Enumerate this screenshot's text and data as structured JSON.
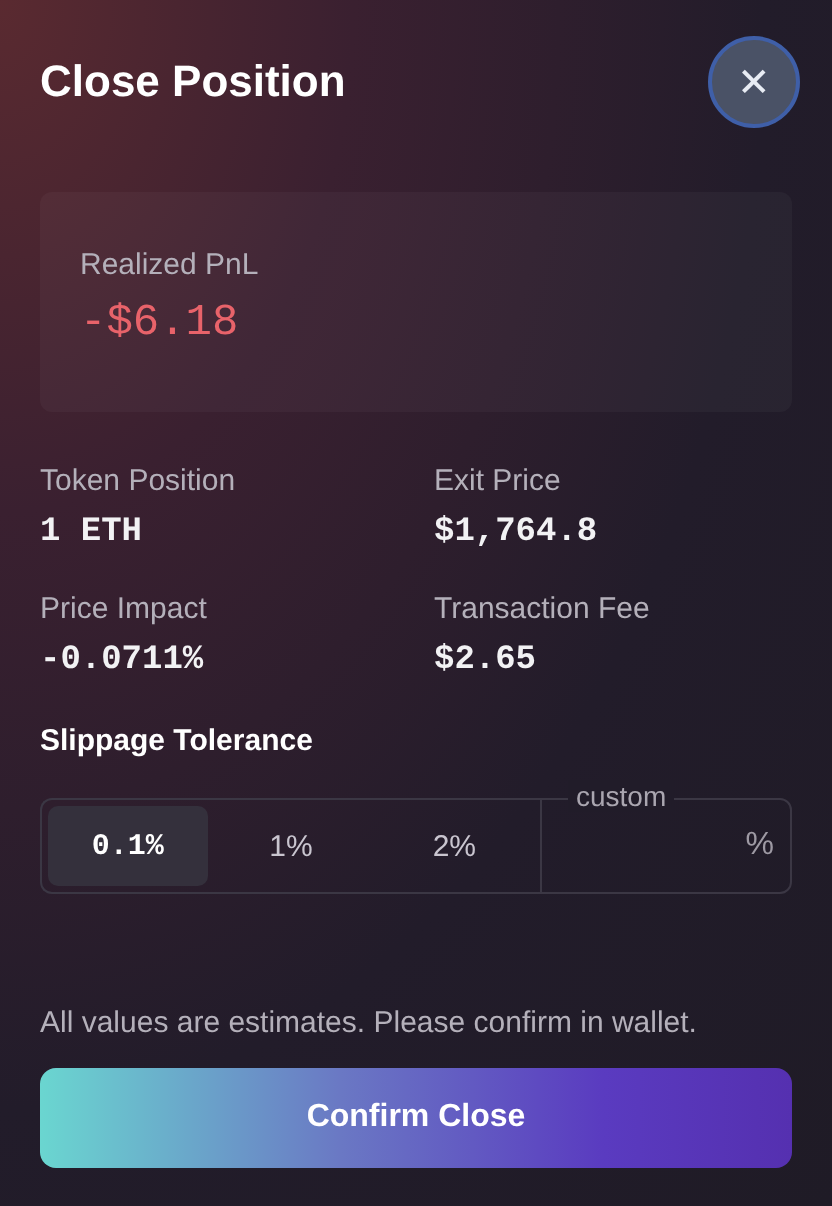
{
  "dialog": {
    "title": "Close Position",
    "close_label": "✕"
  },
  "pnl": {
    "label": "Realized PnL",
    "value": "-$6.18",
    "negative": true
  },
  "stats": [
    {
      "label": "Token Position",
      "value": "1 ETH"
    },
    {
      "label": "Exit Price",
      "value": "$1,764.8"
    },
    {
      "label": "Price Impact",
      "value": "-0.0711%"
    },
    {
      "label": "Transaction Fee",
      "value": "$2.65"
    }
  ],
  "slippage": {
    "label": "Slippage Tolerance",
    "options": [
      {
        "label": "0.1%",
        "selected": true
      },
      {
        "label": "1%",
        "selected": false
      },
      {
        "label": "2%",
        "selected": false
      }
    ],
    "custom": {
      "label": "custom",
      "suffix": "%"
    }
  },
  "note": "All values are estimates. Please confirm in wallet.",
  "confirm_button": "Confirm Close"
}
